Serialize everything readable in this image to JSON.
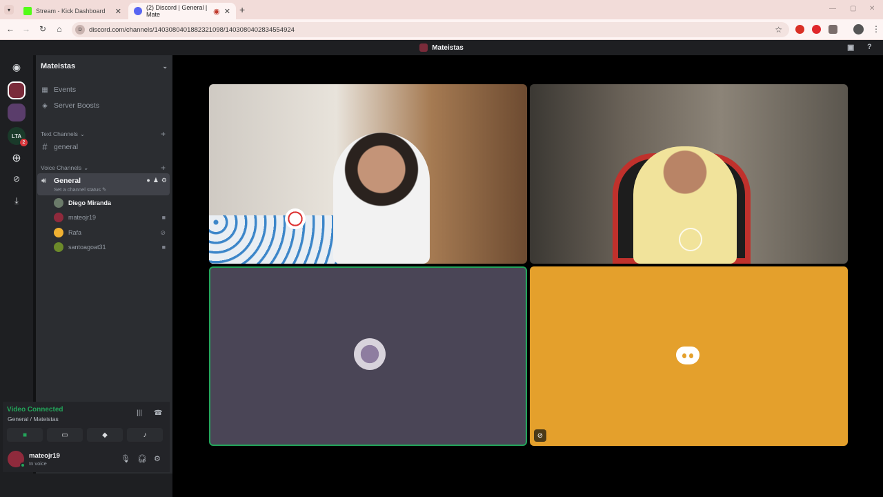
{
  "browser": {
    "tabs": [
      {
        "title": "Stream - Kick Dashboard",
        "favicon_color": "#53fc18"
      },
      {
        "title": "(2) Discord | General | Mate",
        "favicon_color": "#5865f2"
      }
    ],
    "url": "discord.com/channels/1403080401882321098/1403080402834554924"
  },
  "discord": {
    "window_title": "Mateistas",
    "server_name": "Mateistas",
    "menu": {
      "events": "Events",
      "server_boosts": "Server Boosts"
    },
    "categories": {
      "text": "Text Channels",
      "voice": "Voice Channels"
    },
    "text_channel": "general",
    "voice_channel": {
      "name": "General",
      "status_placeholder": "Set a channel status"
    },
    "rail_badge": "LTA",
    "rail_badge_count": "2",
    "members": [
      {
        "name": "Diego Miranda",
        "avatar_color": "#6b7b6a",
        "icon": ""
      },
      {
        "name": "mateojr19",
        "avatar_color": "#8f2a3c",
        "icon": "video-icon"
      },
      {
        "name": "Rafa",
        "avatar_color": "#f0b132",
        "icon": "mic-muted-icon"
      },
      {
        "name": "santoagoat31",
        "avatar_color": "#6c8a2a",
        "icon": "video-icon"
      }
    ],
    "voice_panel": {
      "status": "Video Connected",
      "location": "General / Mateistas"
    },
    "user": {
      "name": "mateojr19",
      "status": "In voice"
    },
    "colors": {
      "connected": "#23a55a",
      "muted_tile": "#e4a02c",
      "idle_tile": "#4a4556"
    }
  }
}
